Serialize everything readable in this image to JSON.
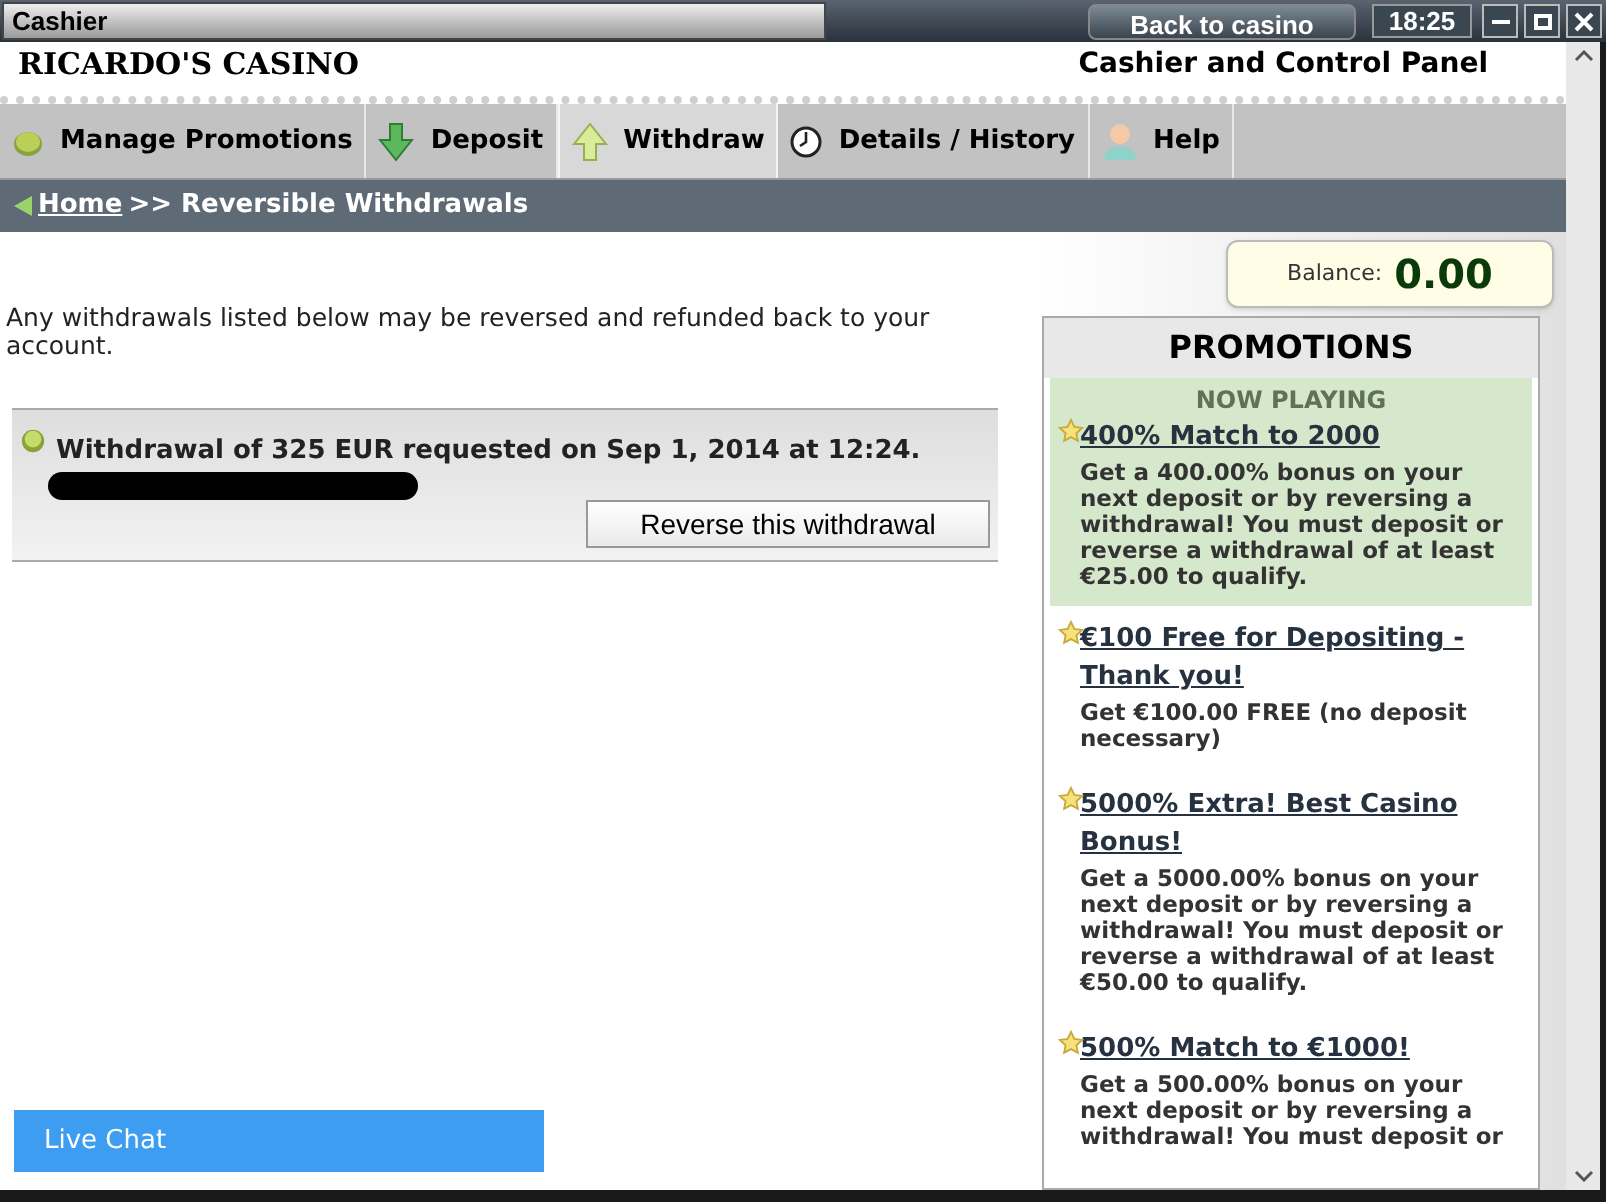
{
  "window": {
    "title": "Cashier",
    "back_button": "Back to casino",
    "clock": "18:25"
  },
  "header": {
    "brand": "RICARDO'S CASINO",
    "subtitle": "Cashier and Control Panel"
  },
  "tabs": [
    {
      "label": "Manage Promotions",
      "kind": "coin",
      "selected": false
    },
    {
      "label": "Deposit",
      "kind": "down",
      "selected": false
    },
    {
      "label": "Withdraw",
      "kind": "up",
      "selected": true
    },
    {
      "label": "Details / History",
      "kind": "clock",
      "selected": false
    },
    {
      "label": "Help",
      "kind": "person",
      "selected": false
    }
  ],
  "breadcrumb": {
    "home": "Home",
    "current": ">> Reversible Withdrawals"
  },
  "intro": "Any withdrawals listed below may be reversed and refunded back to your account.",
  "withdrawals": [
    {
      "text": "Withdrawal of 325 EUR requested on Sep 1, 2014 at 12:24.",
      "button": "Reverse this withdrawal"
    }
  ],
  "live_chat": "Live Chat",
  "balance": {
    "label": "Balance:",
    "value": "0.00"
  },
  "promotions": {
    "title": "PROMOTIONS",
    "items": [
      {
        "status": "NOW PLAYING",
        "title": "400% Match to 2000",
        "description": "Get a 400.00% bonus on your next deposit or by reversing a withdrawal! You must deposit or reverse a withdrawal of at least €25.00 to qualify.",
        "selected": true
      },
      {
        "title": "€100 Free for Depositing - Thank you!",
        "description": "Get €100.00 FREE (no deposit necessary)",
        "selected": false
      },
      {
        "title": "5000% Extra! Best Casino Bonus!",
        "description": "Get a 5000.00% bonus on your next deposit or by reversing a withdrawal! You must deposit or reverse a withdrawal of at least €50.00 to qualify.",
        "selected": false
      },
      {
        "title": "500% Match to €1000!",
        "description": "Get a 500.00% bonus on your next deposit or by reversing a withdrawal! You must deposit or",
        "selected": false
      }
    ]
  }
}
